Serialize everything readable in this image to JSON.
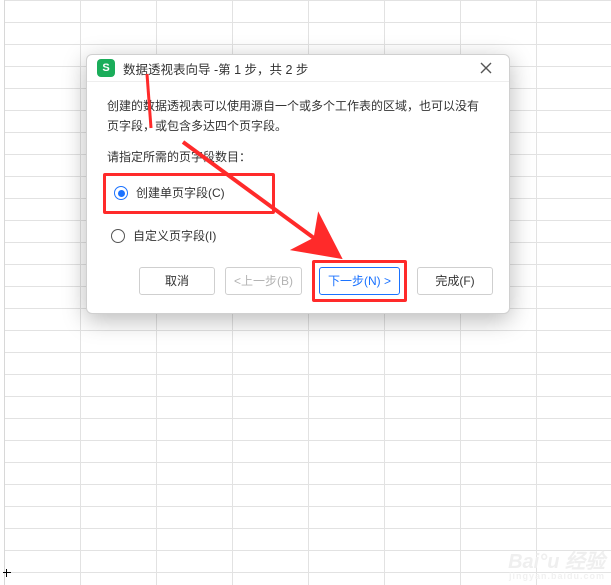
{
  "dialog": {
    "title": "数据透视表向导 -第 1 步，共 2 步",
    "description": "创建的数据透视表可以使用源自一个或多个工作表的区域，也可以没有页字段，或包含多达四个页字段。",
    "prompt": "请指定所需的页字段数目：",
    "options": {
      "single_page": "创建单页字段(C)",
      "custom_page": "自定义页字段(I)"
    },
    "selected_option": "single_page",
    "buttons": {
      "cancel": "取消",
      "back": "<上一步(B)",
      "next": "下一步(N) >",
      "finish": "完成(F)"
    }
  },
  "icons": {
    "app": "S",
    "close": "close-icon"
  },
  "watermark": {
    "main": "Bai°u 经验",
    "sub": "jingyan.baidu.com"
  }
}
